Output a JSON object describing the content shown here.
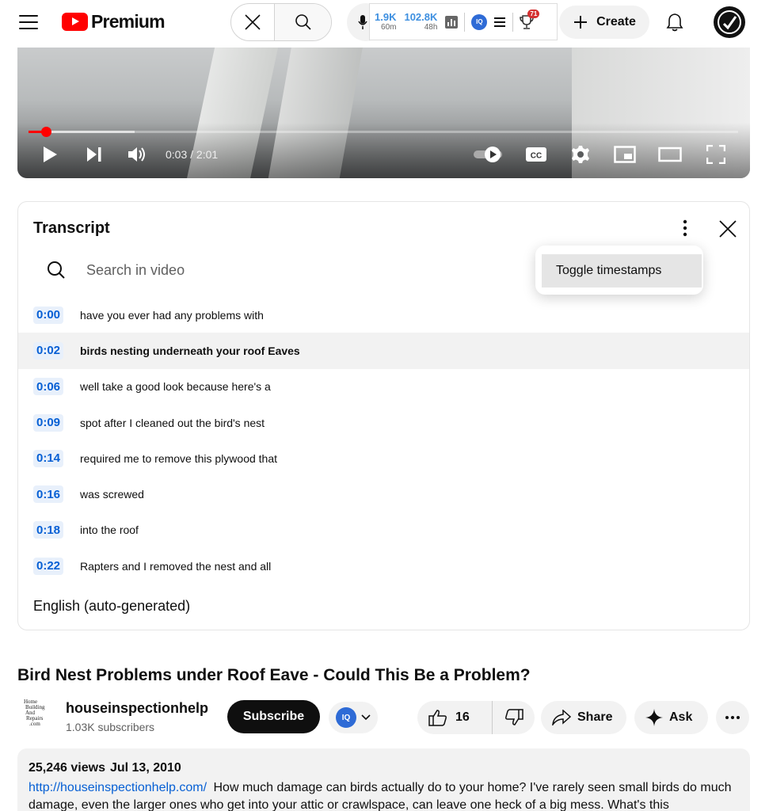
{
  "header": {
    "logo_text": "Premium",
    "ext_stats": [
      {
        "value": "1.9K",
        "sub": "60m"
      },
      {
        "value": "102.8K",
        "sub": "48h"
      }
    ],
    "vidiq_label": "IQ",
    "trophy_count": "71",
    "create_label": "Create",
    "brand_color": "#ff0000"
  },
  "player": {
    "time_display": "0:03 / 2:01",
    "progress_fraction": 0.025,
    "loaded_fraction": 0.15,
    "cc_label": "CC"
  },
  "transcript": {
    "title": "Transcript",
    "search_placeholder": "Search in video",
    "menu_item": "Toggle timestamps",
    "language": "English (auto-generated)",
    "segments": [
      {
        "time": "0:00",
        "text": "have you ever had any problems with",
        "active": false
      },
      {
        "time": "0:02",
        "text": "birds nesting underneath your roof Eaves",
        "active": true
      },
      {
        "time": "0:06",
        "text": "well take a good look because here's a",
        "active": false
      },
      {
        "time": "0:09",
        "text": "spot after I cleaned out the bird's nest",
        "active": false
      },
      {
        "time": "0:14",
        "text": "required me to remove this plywood that",
        "active": false
      },
      {
        "time": "0:16",
        "text": "was screwed",
        "active": false
      },
      {
        "time": "0:18",
        "text": "into the roof",
        "active": false
      },
      {
        "time": "0:22",
        "text": "Rapters and I removed the nest and all",
        "active": false
      }
    ]
  },
  "video": {
    "title": "Bird Nest Problems under Roof Eave - Could This Be a Problem?",
    "channel_avatar_lines": [
      "Home",
      "Building",
      "And",
      "Repairs",
      ".com"
    ],
    "channel_name": "houseinspectionhelp",
    "subscribers": "1.03K subscribers",
    "subscribe_label": "Subscribe",
    "vidiq_label": "IQ",
    "likes": "16",
    "share_label": "Share",
    "ask_label": "Ask",
    "views": "25,246 views",
    "date": "Jul 13, 2010",
    "desc_link": "http://houseinspectionhelp.com/",
    "desc_text": "How much damage can birds actually do to your home?  I've rarely seen small birds do much damage, even the larger ones who get into your attic or crawlspace, can leave one heck of a big mess.  What's this"
  }
}
